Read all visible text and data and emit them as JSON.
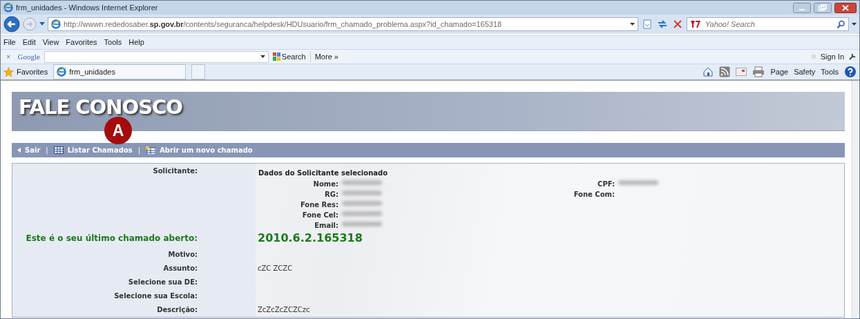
{
  "window": {
    "title": "frm_unidades - Windows Internet Explorer"
  },
  "address": {
    "url": "http://wwwn.rededosaber.**sp.gov.br**/contents/seguranca/helpdesk/HDUsuario/frm_chamado_problema.aspx?id_chamado=165318",
    "search_placeholder": "Yahoo! Search"
  },
  "menu": [
    "File",
    "Edit",
    "View",
    "Favorites",
    "Tools",
    "Help"
  ],
  "google_bar": {
    "close": "×",
    "logo": "Google",
    "search": "Search",
    "more": "More »",
    "sign_in": "Sign In"
  },
  "favorites_bar": {
    "favorites": "Favorites",
    "tab": "frm_unidades",
    "commands": [
      "Page",
      "Safety",
      "Tools"
    ]
  },
  "page": {
    "banner": "FALE CONOSCO",
    "annotation": "A",
    "nav_separator": "|",
    "nav": [
      {
        "kind": "back",
        "label": "Sair"
      },
      {
        "kind": "list",
        "label": "Listar Chamados"
      },
      {
        "kind": "new",
        "label": "Abrir um novo chamado"
      }
    ],
    "requester": {
      "label": "Solicitante:",
      "heading": "Dados do Solicitante selecionado",
      "fields_left": [
        {
          "label": "Nome:",
          "redacted": true
        },
        {
          "label": "RG:",
          "redacted": true
        },
        {
          "label": "Fone Res:",
          "redacted": true
        },
        {
          "label": "Fone Cel:",
          "redacted": true
        },
        {
          "label": "Email:",
          "redacted": true
        }
      ],
      "fields_right": [
        {
          "label": "CPF:",
          "redacted": true
        },
        {
          "label": "Fone Com:"
        }
      ]
    },
    "rows": [
      {
        "kind": "highlight",
        "label": "Este é o seu último chamado aberto:",
        "value": "2010.6.2.165318"
      },
      {
        "kind": "plain",
        "label": "Motivo:"
      },
      {
        "kind": "plain",
        "label": "Assunto:",
        "value": "cZC ZCZC"
      },
      {
        "kind": "plain",
        "label": "Selecione sua DE:"
      },
      {
        "kind": "plain",
        "label": "Selecione sua Escola:"
      },
      {
        "kind": "plain",
        "label": "Descrição:",
        "value": "ZcZcZcZCZCzc"
      }
    ]
  }
}
